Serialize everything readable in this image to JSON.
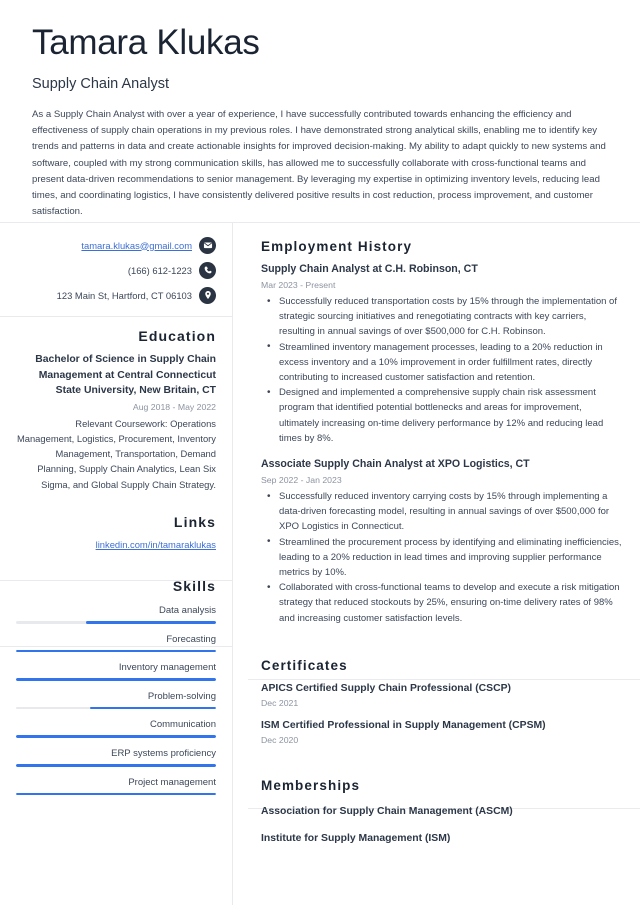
{
  "header": {
    "full_name": "Tamara Klukas",
    "job_title": "Supply Chain Analyst",
    "summary": "As a Supply Chain Analyst with over a year of experience, I have successfully contributed towards enhancing the efficiency and effectiveness of supply chain operations in my previous roles. I have demonstrated strong analytical skills, enabling me to identify key trends and patterns in data and create actionable insights for improved decision-making. My ability to adapt quickly to new systems and software, coupled with my strong communication skills, has allowed me to successfully collaborate with cross-functional teams and present data-driven recommendations to senior management. By leveraging my expertise in optimizing inventory levels, reducing lead times, and coordinating logistics, I have consistently delivered positive results in cost reduction, process improvement, and customer satisfaction."
  },
  "contacts": [
    {
      "text": "tamara.klukas@gmail.com",
      "icon": "envelope-icon",
      "is_link": true
    },
    {
      "text": "(166) 612-1223",
      "icon": "phone-icon",
      "is_link": false
    },
    {
      "text": "123 Main St, Hartford, CT 06103",
      "icon": "location-pin-icon",
      "is_link": false
    }
  ],
  "education": {
    "heading": "Education",
    "degree": "Bachelor of Science in Supply Chain Management at Central Connecticut State University, New Britain, CT",
    "dates": "Aug 2018 - May 2022",
    "description": "Relevant Coursework: Operations Management, Logistics, Procurement, Inventory Management, Transportation, Demand Planning, Supply Chain Analytics, Lean Six Sigma, and Global Supply Chain Strategy."
  },
  "links": {
    "heading": "Links",
    "items": [
      {
        "label": "linkedin.com/in/tamaraklukas"
      }
    ]
  },
  "skills": {
    "heading": "Skills",
    "items": [
      {
        "label": "Data analysis",
        "level": 65
      },
      {
        "label": "Forecasting",
        "level": 100
      },
      {
        "label": "Inventory management",
        "level": 100
      },
      {
        "label": "Problem-solving",
        "level": 63
      },
      {
        "label": "Communication",
        "level": 100
      },
      {
        "label": "ERP systems proficiency",
        "level": 100
      },
      {
        "label": "Project management",
        "level": 100
      }
    ]
  },
  "employment": {
    "heading": "Employment History",
    "jobs": [
      {
        "role": "Supply Chain Analyst at C.H. Robinson, CT",
        "dates": "Mar 2023 - Present",
        "bullets": [
          "Successfully reduced transportation costs by 15% through the implementation of strategic sourcing initiatives and renegotiating contracts with key carriers, resulting in annual savings of over $500,000 for C.H. Robinson.",
          "Streamlined inventory management processes, leading to a 20% reduction in excess inventory and a 10% improvement in order fulfillment rates, directly contributing to increased customer satisfaction and retention.",
          "Designed and implemented a comprehensive supply chain risk assessment program that identified potential bottlenecks and areas for improvement, ultimately increasing on-time delivery performance by 12% and reducing lead times by 8%."
        ]
      },
      {
        "role": "Associate Supply Chain Analyst at XPO Logistics, CT",
        "dates": "Sep 2022 - Jan 2023",
        "bullets": [
          "Successfully reduced inventory carrying costs by 15% through implementing a data-driven forecasting model, resulting in annual savings of over $500,000 for XPO Logistics in Connecticut.",
          "Streamlined the procurement process by identifying and eliminating inefficiencies, leading to a 20% reduction in lead times and improving supplier performance metrics by 10%.",
          "Collaborated with cross-functional teams to develop and execute a risk mitigation strategy that reduced stockouts by 25%, ensuring on-time delivery rates of 98% and increasing customer satisfaction levels."
        ]
      }
    ]
  },
  "certificates": {
    "heading": "Certificates",
    "items": [
      {
        "name": "APICS Certified Supply Chain Professional (CSCP)",
        "date": "Dec 2021"
      },
      {
        "name": "ISM Certified Professional in Supply Management (CPSM)",
        "date": "Dec 2020"
      }
    ]
  },
  "memberships": {
    "heading": "Memberships",
    "items": [
      {
        "name": "Association for Supply Chain Management (ASCM)"
      },
      {
        "name": "Institute for Supply Management (ISM)"
      }
    ]
  },
  "theme": {
    "accent_blue": "#3274ec",
    "link_blue": "#3d6fd4",
    "heading_dark": "#1b2432",
    "body_text": "#3c4759",
    "muted_text": "#8c93a0",
    "divider": "#e8eaee",
    "badge_dark": "#2b3443"
  }
}
